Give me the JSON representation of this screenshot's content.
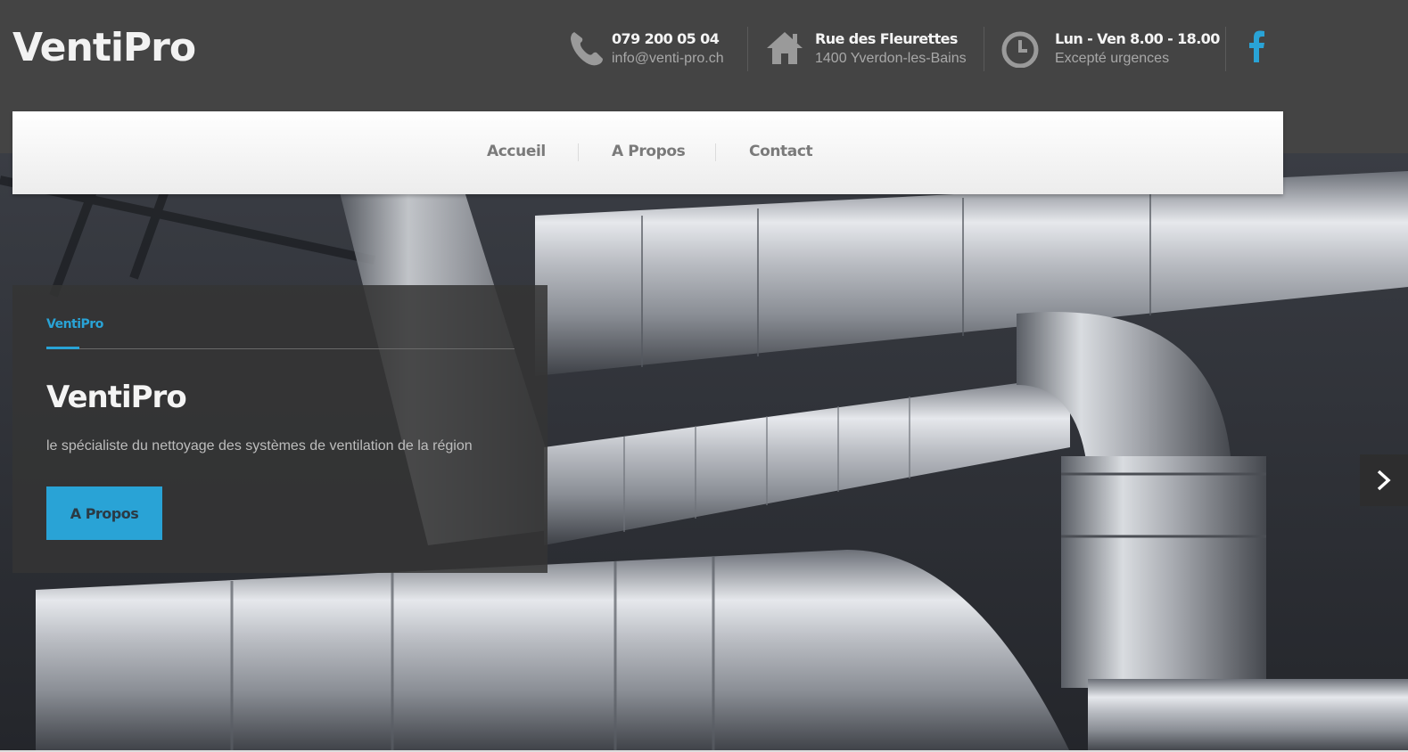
{
  "brand": {
    "logo": "VentiPro"
  },
  "contact": {
    "phone": {
      "line1": "079 200 05 04",
      "line2": "info@venti-pro.ch",
      "icon": "phone-icon"
    },
    "address": {
      "line1": "Rue des Fleurettes",
      "line2": "1400 Yverdon-les-Bains",
      "icon": "home-icon"
    },
    "hours": {
      "line1": "Lun - Ven 8.00 - 18.00",
      "line2": "Excepté urgences",
      "icon": "clock-icon"
    },
    "social": {
      "icon": "facebook-icon"
    }
  },
  "nav": {
    "items": [
      {
        "label": "Accueil"
      },
      {
        "label": "A Propos"
      },
      {
        "label": "Contact"
      }
    ]
  },
  "slide": {
    "kicker": "VentiPro",
    "title": "VentiPro",
    "text": "le spécialiste du nettoyage des systèmes de ventilation de la région",
    "button_label": "A Propos",
    "next_icon": "chevron-right-icon"
  },
  "colors": {
    "accent": "#29a3d6",
    "header_bg": "#444444",
    "nav_bg": "#f5f5f5",
    "nav_text": "#7a7a7a"
  }
}
